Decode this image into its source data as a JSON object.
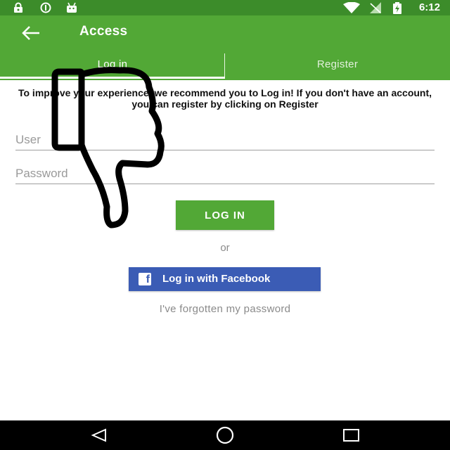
{
  "status_bar": {
    "time": "6:12",
    "icons": [
      "lock-icon",
      "sync-icon",
      "android-icon",
      "wifi-icon",
      "signal-icon",
      "battery-charging-icon"
    ]
  },
  "app_bar": {
    "title": "Access",
    "back_icon": "arrow-left-icon"
  },
  "tabs": [
    {
      "label": "Log in",
      "selected": true
    },
    {
      "label": "Register",
      "selected": false
    }
  ],
  "intro_text": "To improve your experience, we recommend you to Log in! If you don't have an account, you can register by clicking on Register",
  "form": {
    "username_placeholder": "User",
    "password_placeholder": "Password",
    "login_button_label": "LOG IN",
    "or_label": "or",
    "facebook_button_label": "Log in with Facebook",
    "facebook_icon": "facebook-icon",
    "forgot_password_label": "I've forgotten my password"
  },
  "nav_bar": {
    "icons": [
      "back-triangle-icon",
      "home-circle-icon",
      "recents-square-icon"
    ]
  },
  "overlay": {
    "icon": "thumbs-down-icon"
  },
  "colors": {
    "status_bar": "#3c8c2a",
    "app_bar": "#52a836",
    "login_button": "#52a836",
    "facebook_button": "#3b5cb5",
    "nav_bar": "#000000"
  }
}
